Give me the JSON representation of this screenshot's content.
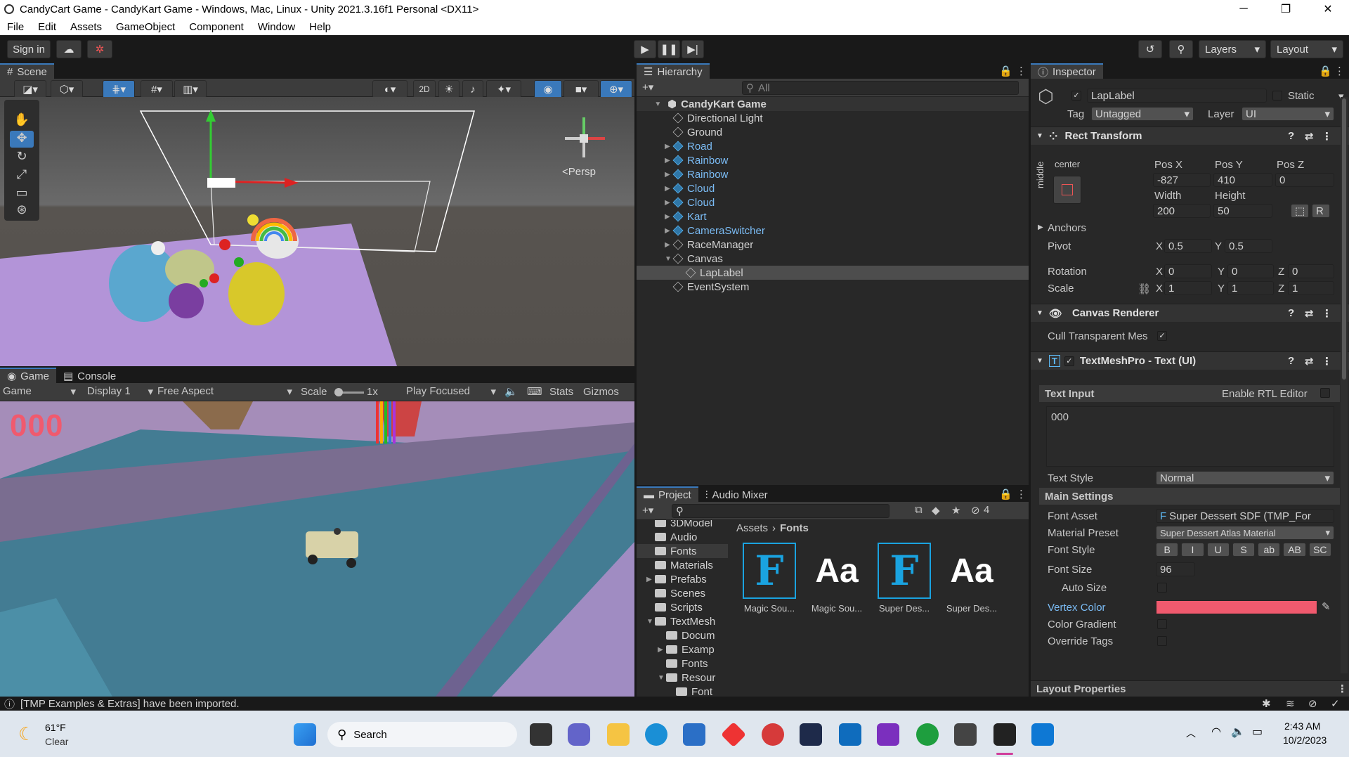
{
  "window": {
    "title": "CandyCart Game - CandyKart Game - Windows, Mac, Linux - Unity 2021.3.16f1 Personal <DX11>"
  },
  "menu": [
    "File",
    "Edit",
    "Assets",
    "GameObject",
    "Component",
    "Window",
    "Help"
  ],
  "toolbar": {
    "sign_in": "Sign in",
    "layers": "Layers",
    "layout": "Layout"
  },
  "scene": {
    "tab": "Scene",
    "persp": "<Persp",
    "btn_2d": "2D"
  },
  "game": {
    "tab": "Game",
    "console_tab": "Console",
    "game_dd": "Game",
    "display": "Display 1",
    "aspect": "Free Aspect",
    "scale_label": "Scale",
    "scale_val": "1x",
    "play_focused": "Play Focused",
    "stats": "Stats",
    "gizmos": "Gizmos",
    "lap_text": "000"
  },
  "hierarchy": {
    "tab": "Hierarchy",
    "search_placeholder": "All",
    "root": "CandyKart Game",
    "items": [
      {
        "label": "Directional Light",
        "prefab": false,
        "arrow": ""
      },
      {
        "label": "Ground",
        "prefab": false,
        "arrow": ""
      },
      {
        "label": "Road",
        "prefab": true,
        "arrow": "▶"
      },
      {
        "label": "Rainbow",
        "prefab": true,
        "arrow": "▶"
      },
      {
        "label": "Rainbow",
        "prefab": true,
        "arrow": "▶"
      },
      {
        "label": "Cloud",
        "prefab": true,
        "arrow": "▶"
      },
      {
        "label": "Cloud",
        "prefab": true,
        "arrow": "▶"
      },
      {
        "label": "Kart",
        "prefab": true,
        "arrow": "▶"
      },
      {
        "label": "CameraSwitcher",
        "prefab": true,
        "arrow": "▶"
      },
      {
        "label": "RaceManager",
        "prefab": false,
        "arrow": "▶"
      },
      {
        "label": "Canvas",
        "prefab": false,
        "arrow": "▼"
      },
      {
        "label": "LapLabel",
        "prefab": false,
        "arrow": "",
        "child": true,
        "selected": true
      },
      {
        "label": "EventSystem",
        "prefab": false,
        "arrow": ""
      }
    ]
  },
  "project": {
    "tab": "Project",
    "mixer_tab": "Audio Mixer",
    "count": "4",
    "breadcrumb_root": "Assets",
    "breadcrumb_current": "Fonts",
    "tree": [
      "3DModel",
      "Audio",
      "Fonts",
      "Materials",
      "Prefabs",
      "Scenes",
      "Scripts",
      "TextMesh",
      "Docum",
      "Examp",
      "Fonts",
      "Resour",
      "Font"
    ],
    "assets": [
      {
        "label": "Magic Sou...",
        "kind": "F"
      },
      {
        "label": "Magic Sou...",
        "kind": "Aa"
      },
      {
        "label": "Super Des...",
        "kind": "F"
      },
      {
        "label": "Super Des...",
        "kind": "Aa"
      }
    ]
  },
  "inspector": {
    "tab": "Inspector",
    "name": "LapLabel",
    "static": "Static",
    "tag_label": "Tag",
    "tag": "Untagged",
    "layer_label": "Layer",
    "layer": "UI",
    "rect_transform": "Rect Transform",
    "center": "center",
    "middle": "middle",
    "posx_label": "Pos X",
    "posy_label": "Pos Y",
    "posz_label": "Pos Z",
    "posx": "-827",
    "posy": "410",
    "posz": "0",
    "width_label": "Width",
    "height_label": "Height",
    "width": "200",
    "height": "50",
    "anchors": "Anchors",
    "pivot": "Pivot",
    "pivot_x": "0.5",
    "pivot_y": "0.5",
    "rotation": "Rotation",
    "rot_x": "0",
    "rot_y": "0",
    "rot_z": "0",
    "scale": "Scale",
    "scale_x": "1",
    "scale_y": "1",
    "scale_z": "1",
    "canvas_renderer": "Canvas Renderer",
    "cull": "Cull Transparent Mes",
    "tmp": "TextMeshPro - Text (UI)",
    "text_input": "Text Input",
    "rtl": "Enable RTL Editor",
    "text_value": "000",
    "text_style_label": "Text Style",
    "text_style": "Normal",
    "main_settings": "Main Settings",
    "font_asset_label": "Font Asset",
    "font_asset": "Super Dessert SDF (TMP_For",
    "material_preset_label": "Material Preset",
    "material_preset": "Super Dessert Atlas Material",
    "font_style_label": "Font Style",
    "font_styles": [
      "B",
      "I",
      "U",
      "S",
      "ab",
      "AB",
      "SC"
    ],
    "font_size_label": "Font Size",
    "font_size": "96",
    "auto_size": "Auto Size",
    "vertex_color_label": "Vertex Color",
    "vertex_color": "#f05a6e",
    "color_gradient": "Color Gradient",
    "override_tags": "Override Tags",
    "layout_properties": "Layout Properties"
  },
  "status": {
    "message": "[TMP Examples & Extras] have been imported."
  },
  "taskbar": {
    "temp": "61°F",
    "weather": "Clear",
    "search": "Search",
    "time": "2:43 AM",
    "date": "10/2/2023"
  }
}
